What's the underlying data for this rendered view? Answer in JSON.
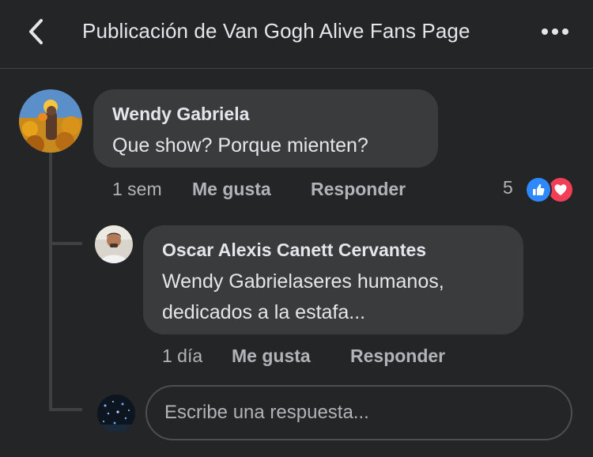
{
  "header": {
    "title": "Publicación de Van Gogh Alive Fans Page"
  },
  "comment": {
    "author": "Wendy Gabriela",
    "text": "Que show? Porque mienten?",
    "time": "1 sem",
    "like_label": "Me gusta",
    "reply_label": "Responder",
    "reaction_count": "5"
  },
  "reply": {
    "author": "Oscar Alexis Canett Cervantes",
    "text_line1": "Wendy Gabrielaseres humanos,",
    "text_line2": "dedicados a la estafa...",
    "time": "1 día",
    "like_label": "Me gusta",
    "reply_label": "Responder"
  },
  "composer": {
    "placeholder": "Escribe una respuesta..."
  },
  "colors": {
    "background": "#242526",
    "bubble": "#3a3b3c",
    "primary_text": "#e4e6eb",
    "secondary_text": "#b0b3b8",
    "like_blue": "#2e89ff",
    "love_red": "#f33e58"
  },
  "icons": {
    "back": "chevron-left-icon",
    "more": "more-horizontal-icon",
    "like": "thumbs-up-icon",
    "love": "heart-icon"
  }
}
